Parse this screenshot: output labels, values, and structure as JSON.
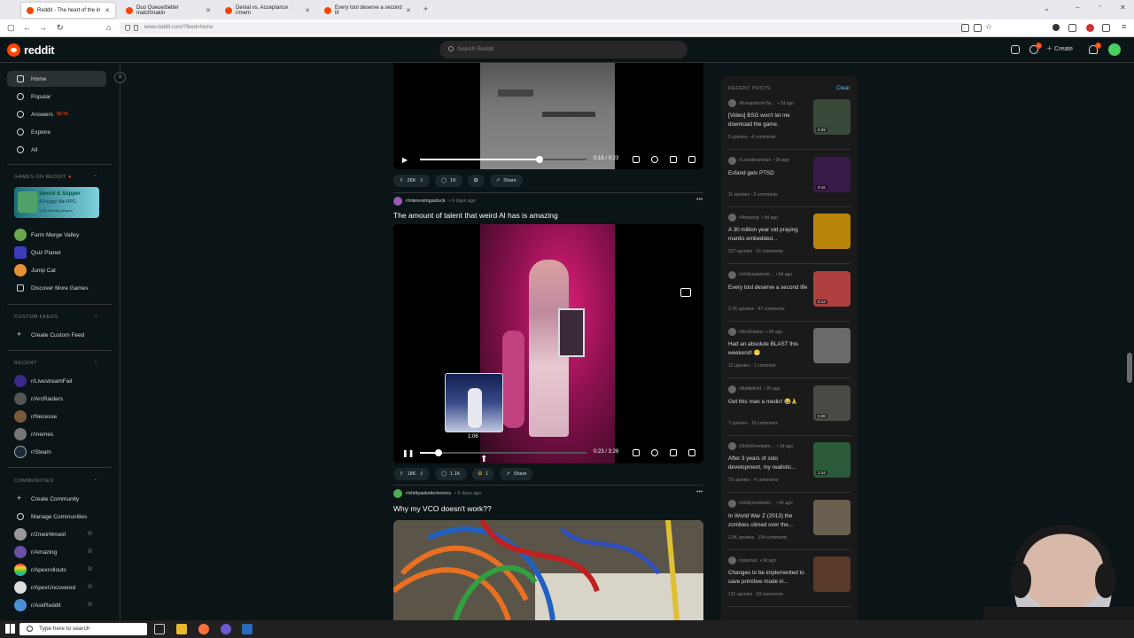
{
  "browser": {
    "tabs": [
      {
        "label": "Reddit - The heart of the in",
        "active": true
      },
      {
        "label": "Duo Queue/better matchmakin",
        "active": false
      },
      {
        "label": "Denial vs. Acceptance : r/mem",
        "active": false
      },
      {
        "label": "Every tool deserve a second lif",
        "active": false
      }
    ],
    "new_tab": "+",
    "url": "www.reddit.com/?feed=home"
  },
  "header": {
    "logo_text": "reddit",
    "search_placeholder": "Search Reddit",
    "create_label": "Create",
    "chat_badge": "1",
    "notif_badge": "2"
  },
  "sidebar": {
    "nav": [
      {
        "label": "Home",
        "icon": "home-icon",
        "active": true
      },
      {
        "label": "Popular",
        "icon": "popular-icon"
      },
      {
        "label": "Answers",
        "icon": "answers-icon",
        "badge": "BETA"
      },
      {
        "label": "Explore",
        "icon": "explore-icon"
      },
      {
        "label": "All",
        "icon": "all-icon"
      }
    ],
    "games_heading": "GAMES ON REDDIT",
    "featured_game": {
      "title": "Sword & Supper",
      "subtitle": "A Froggy Idle RPG",
      "meta": "1.2M monthly players"
    },
    "games": [
      "Farm Merge Valley",
      "Quiz Planet",
      "Jump Cat",
      "Discover More Games"
    ],
    "custom_feeds_heading": "CUSTOM FEEDS",
    "create_custom_feed": "Create Custom Feed",
    "recent_heading": "RECENT",
    "recent": [
      "r/LivestreamFail",
      "r/ArcRaiders",
      "r/Necesse",
      "r/memes",
      "r/Steam"
    ],
    "communities_heading": "COMMUNITIES",
    "create_community": "Create Community",
    "manage_communities": "Manage Communities",
    "communities": [
      "r/2meirl4meirl",
      "r/Amazing",
      "r/Apexrollouts",
      "r/ApexUncovered",
      "r/AskReddit"
    ]
  },
  "feed": {
    "post0": {
      "time": "0:16 / 0:23",
      "progress": 0.72,
      "upvotes": "26K",
      "comments": "1K",
      "share": "Share"
    },
    "post1": {
      "subreddit": "r/interestingasfuck",
      "age": "• 6 days ago",
      "title": "The amount of talent that weird Al has is amazing",
      "time": "0:23 / 3:26",
      "progress": 0.11,
      "hover_time": "1:06",
      "upvotes": "18K",
      "comments": "1.1K",
      "awards": "1",
      "share": "Share"
    },
    "post2": {
      "subreddit": "r/shittyaskelectronics",
      "age": "• 5 days ago",
      "title": "Why my VCO doesn't work??"
    }
  },
  "recent_posts": {
    "heading": "RECENT POSTS",
    "clear": "Clear",
    "items": [
      {
        "sub": "r/EscapefromTar...",
        "age": "• 2d ago",
        "title": "[Video] BSG won't let me download the game.",
        "upvotes": "5 upvotes",
        "comments": "4 comments",
        "duration": "0:29",
        "color": "#3a4a3a"
      },
      {
        "sub": "r/LivestreamFail",
        "age": "• 2h ago",
        "title": "Esfand gets PTSD",
        "upvotes": "11 upvotes",
        "comments": "2 comments",
        "duration": "0:16",
        "color": "#3a1a4a"
      },
      {
        "sub": "r/Amazing",
        "age": "• 5d ago",
        "title": "A 30 million year old praying mantis embedded...",
        "upvotes": "227 upvotes",
        "comments": "51 comments",
        "duration": "",
        "color": "#b8860b"
      },
      {
        "sub": "r/shittyaskelectr...",
        "age": "• 6d ago",
        "title": "Every tool deserve a second life",
        "upvotes": "3.7K upvotes",
        "comments": "47 comments",
        "duration": "0:12",
        "color": "#b04040"
      },
      {
        "sub": "r/ArcRaiders",
        "age": "• 9h ago",
        "title": "Had an absolute BLAST this weekend! 😁",
        "upvotes": "12 upvotes",
        "comments": "1 comment",
        "duration": "",
        "color": "#6a6a6a"
      },
      {
        "sub": "r/Battlefield",
        "age": "• 2h ago",
        "title": "Get this man a medic! 😂🙏",
        "upvotes": "7 upvotes",
        "comments": "15 comments",
        "duration": "0:28",
        "color": "#4a4a44"
      },
      {
        "sub": "r/SoloDevelopm...",
        "age": "• 1d ago",
        "title": "After 3 years of solo development, my realistic...",
        "upvotes": "79 upvotes",
        "comments": "4 comments",
        "duration": "1:24",
        "color": "#2a5a3a"
      },
      {
        "sub": "r/shittymoviedet...",
        "age": "• 6h ago",
        "title": "In World War Z (2013) the zombies climed over the...",
        "upvotes": "2.9K upvotes",
        "comments": "134 comments",
        "duration": "",
        "color": "#6a6050"
      },
      {
        "sub": "r/playrust",
        "age": "• 3d ago",
        "title": "Changes to be implemented to save primitive mode in...",
        "upvotes": "131 upvotes",
        "comments": "63 comments",
        "duration": "",
        "color": "#5a3a2a"
      }
    ]
  },
  "taskbar": {
    "search_placeholder": "Type here to search"
  }
}
